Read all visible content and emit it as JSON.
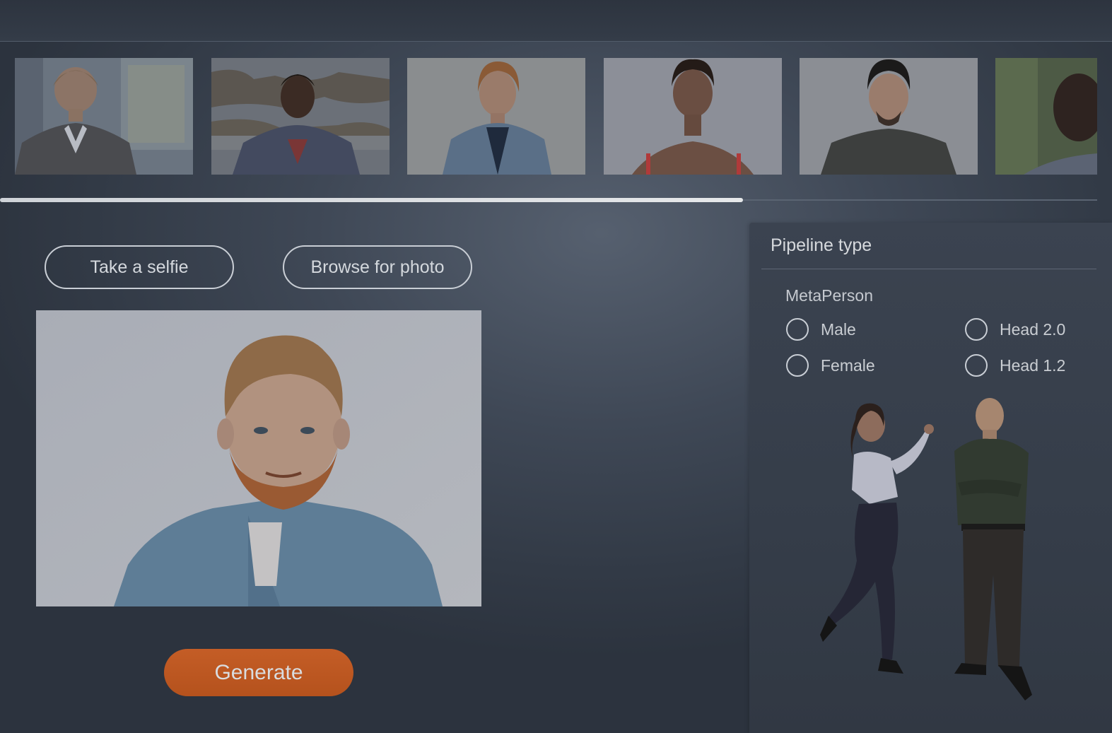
{
  "gallery": {
    "thumbnails": [
      {
        "name": "woman-blazer"
      },
      {
        "name": "man-hoodie-headphones"
      },
      {
        "name": "man-denim-jacket"
      },
      {
        "name": "woman-short-hair"
      },
      {
        "name": "man-beard-tshirt"
      },
      {
        "name": "man-bald-partial"
      }
    ],
    "scroll_fraction": 0.677
  },
  "actions": {
    "selfie_label": "Take a selfie",
    "browse_label": "Browse for photo",
    "generate_label": "Generate"
  },
  "pipeline": {
    "title": "Pipeline type",
    "section": "MetaPerson",
    "options": {
      "male": "Male",
      "female": "Female",
      "head20": "Head 2.0",
      "head12": "Head 1.2"
    }
  },
  "colors": {
    "accent": "#c45d26",
    "outline": "#c9ced5",
    "background": "#3f4856"
  }
}
